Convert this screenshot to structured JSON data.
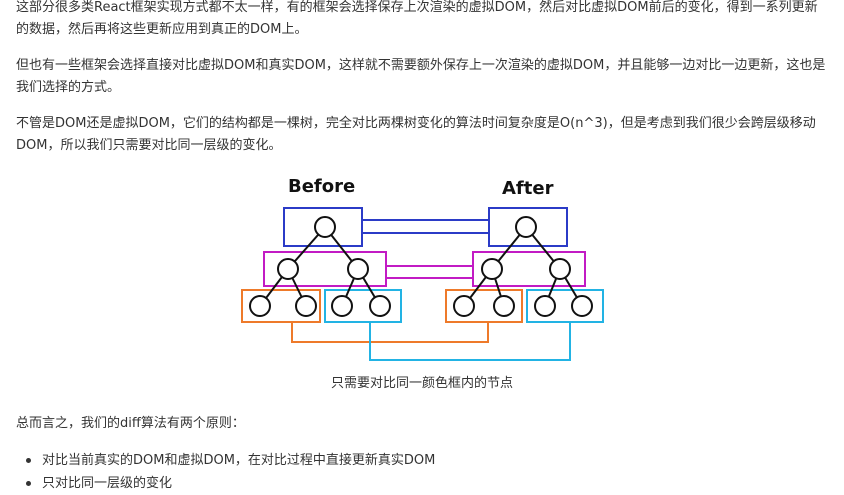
{
  "article": {
    "p1": "这部分很多类React框架实现方式都不太一样，有的框架会选择保存上次渲染的虚拟DOM，然后对比虚拟DOM前后的变化，得到一系列更新的数据，然后再将这些更新应用到真正的DOM上。",
    "p2": "但也有一些框架会选择直接对比虚拟DOM和真实DOM，这样就不需要额外保存上一次渲染的虚拟DOM，并且能够一边对比一边更新，这也是我们选择的方式。",
    "p3": "不管是DOM还是虚拟DOM，它们的结构都是一棵树，完全对比两棵树变化的算法时间复杂度是O(n^3)，但是考虑到我们很少会跨层级移动DOM，所以我们只需要对比同一层级的变化。",
    "summary": "总而言之，我们的diff算法有两个原则：",
    "bullets": [
      "对比当前真实的DOM和虚拟DOM，在对比过程中直接更新真实DOM",
      "只对比同一层级的变化"
    ]
  },
  "figure": {
    "before_label": "Before",
    "after_label": "After",
    "caption": "只需要对比同一颜色框内的节点",
    "colors": {
      "level1": "#2b3bc7",
      "level2": "#c21bc4",
      "level3_left": "#ee7a2a",
      "level3_right": "#22b3e4"
    }
  }
}
